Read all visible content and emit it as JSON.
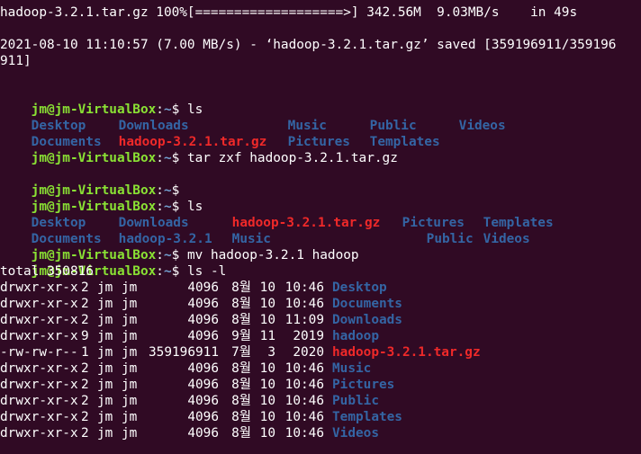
{
  "colors": {
    "background": "#300a24",
    "text": "#ffffff",
    "prompt_user": "#8ae234",
    "prompt_path": "#729fcf",
    "directory": "#3465a4",
    "archive": "#ef2929"
  },
  "prompt": {
    "user": "jm@jm-VirtualBox",
    "colon": ":",
    "path": "~",
    "symbol": "$ "
  },
  "download": {
    "progress_line": "hadoop-3.2.1.tar.gz 100%[===================>] 342.56M  9.03MB/s    in 49s",
    "saved_line_1": "2021-08-10 11:10:57 (7.00 MB/s) - ‘hadoop-3.2.1.tar.gz’ saved [359196911/359196",
    "saved_line_2": "911]"
  },
  "commands": {
    "ls": "ls",
    "tar": "tar zxf hadoop-3.2.1.tar.gz",
    "empty": "",
    "mv": "mv hadoop-3.2.1 hadoop",
    "ls_l": "ls -l"
  },
  "ls1": {
    "row1": [
      {
        "name": "Desktop",
        "kind": "dir"
      },
      {
        "name": "Downloads",
        "kind": "dir"
      },
      {
        "name": "Music",
        "kind": "dir"
      },
      {
        "name": "Public",
        "kind": "dir"
      },
      {
        "name": "Videos",
        "kind": "dir"
      }
    ],
    "row2": [
      {
        "name": "Documents",
        "kind": "dir"
      },
      {
        "name": "hadoop-3.2.1.tar.gz",
        "kind": "arch"
      },
      {
        "name": "Pictures",
        "kind": "dir"
      },
      {
        "name": "Templates",
        "kind": "dir"
      }
    ]
  },
  "ls2": {
    "row1": [
      {
        "name": "Desktop",
        "kind": "dir"
      },
      {
        "name": "Downloads",
        "kind": "dir"
      },
      {
        "name": "hadoop-3.2.1.tar.gz",
        "kind": "arch"
      },
      {
        "name": "Pictures",
        "kind": "dir"
      },
      {
        "name": "Templates",
        "kind": "dir"
      }
    ],
    "row2": [
      {
        "name": "Documents",
        "kind": "dir"
      },
      {
        "name": "hadoop-3.2.1",
        "kind": "dir"
      },
      {
        "name": "Music",
        "kind": "dir"
      },
      {
        "name": "Public",
        "kind": "dir"
      },
      {
        "name": "Videos",
        "kind": "dir"
      }
    ]
  },
  "ls_long": {
    "total": "total 350816",
    "entries": [
      {
        "perms": "drwxr-xr-x",
        "links": "2",
        "owner": "jm",
        "group": "jm",
        "size": "4096",
        "month": "8월",
        "day": "10",
        "time": "10:46",
        "name": "Desktop",
        "kind": "dir"
      },
      {
        "perms": "drwxr-xr-x",
        "links": "2",
        "owner": "jm",
        "group": "jm",
        "size": "4096",
        "month": "8월",
        "day": "10",
        "time": "10:46",
        "name": "Documents",
        "kind": "dir"
      },
      {
        "perms": "drwxr-xr-x",
        "links": "2",
        "owner": "jm",
        "group": "jm",
        "size": "4096",
        "month": "8월",
        "day": "10",
        "time": "11:09",
        "name": "Downloads",
        "kind": "dir"
      },
      {
        "perms": "drwxr-xr-x",
        "links": "9",
        "owner": "jm",
        "group": "jm",
        "size": "4096",
        "month": "9월",
        "day": "11",
        "time": " 2019",
        "name": "hadoop",
        "kind": "dir"
      },
      {
        "perms": "-rw-rw-r--",
        "links": "1",
        "owner": "jm",
        "group": "jm",
        "size": "359196911",
        "month": "7월",
        "day": " 3",
        "time": " 2020",
        "name": "hadoop-3.2.1.tar.gz",
        "kind": "arch"
      },
      {
        "perms": "drwxr-xr-x",
        "links": "2",
        "owner": "jm",
        "group": "jm",
        "size": "4096",
        "month": "8월",
        "day": "10",
        "time": "10:46",
        "name": "Music",
        "kind": "dir"
      },
      {
        "perms": "drwxr-xr-x",
        "links": "2",
        "owner": "jm",
        "group": "jm",
        "size": "4096",
        "month": "8월",
        "day": "10",
        "time": "10:46",
        "name": "Pictures",
        "kind": "dir"
      },
      {
        "perms": "drwxr-xr-x",
        "links": "2",
        "owner": "jm",
        "group": "jm",
        "size": "4096",
        "month": "8월",
        "day": "10",
        "time": "10:46",
        "name": "Public",
        "kind": "dir"
      },
      {
        "perms": "drwxr-xr-x",
        "links": "2",
        "owner": "jm",
        "group": "jm",
        "size": "4096",
        "month": "8월",
        "day": "10",
        "time": "10:46",
        "name": "Templates",
        "kind": "dir"
      },
      {
        "perms": "drwxr-xr-x",
        "links": "2",
        "owner": "jm",
        "group": "jm",
        "size": "4096",
        "month": "8월",
        "day": "10",
        "time": "10:46",
        "name": "Videos",
        "kind": "dir"
      }
    ]
  }
}
